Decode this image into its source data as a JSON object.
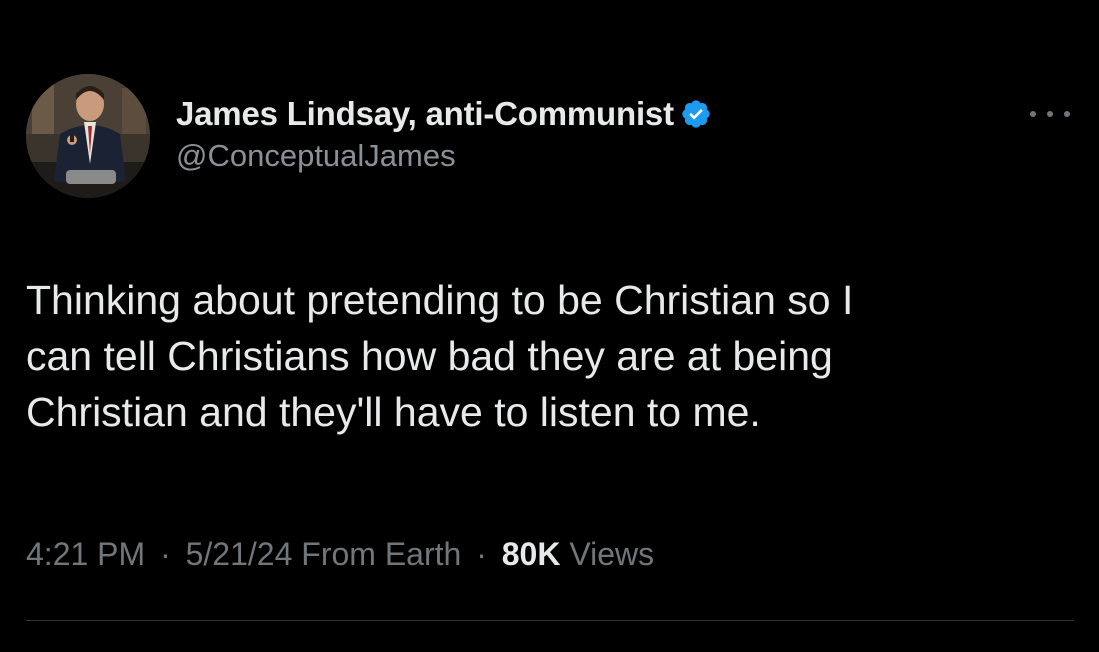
{
  "tweet": {
    "author": {
      "display_name": "James Lindsay, anti-Communist",
      "handle": "@ConceptualJames",
      "verified": true,
      "verified_icon": "verified-badge-icon",
      "avatar_icon": "profile-photo"
    },
    "more_icon": "more-options-icon",
    "text": "Thinking about pretending to be Christian so I\ncan tell Christians how bad they are at being\nChristian and they'll have to listen to me.",
    "meta": {
      "time": "4:21 PM",
      "separator": "·",
      "date": "5/21/24",
      "source": "From Earth",
      "views_count": "80K",
      "views_label": "Views"
    }
  },
  "colors": {
    "background": "#000000",
    "primary_text": "#e7e9ea",
    "secondary_text": "#71767b",
    "verified_blue": "#1d9bf0",
    "divider": "#2f3336"
  }
}
